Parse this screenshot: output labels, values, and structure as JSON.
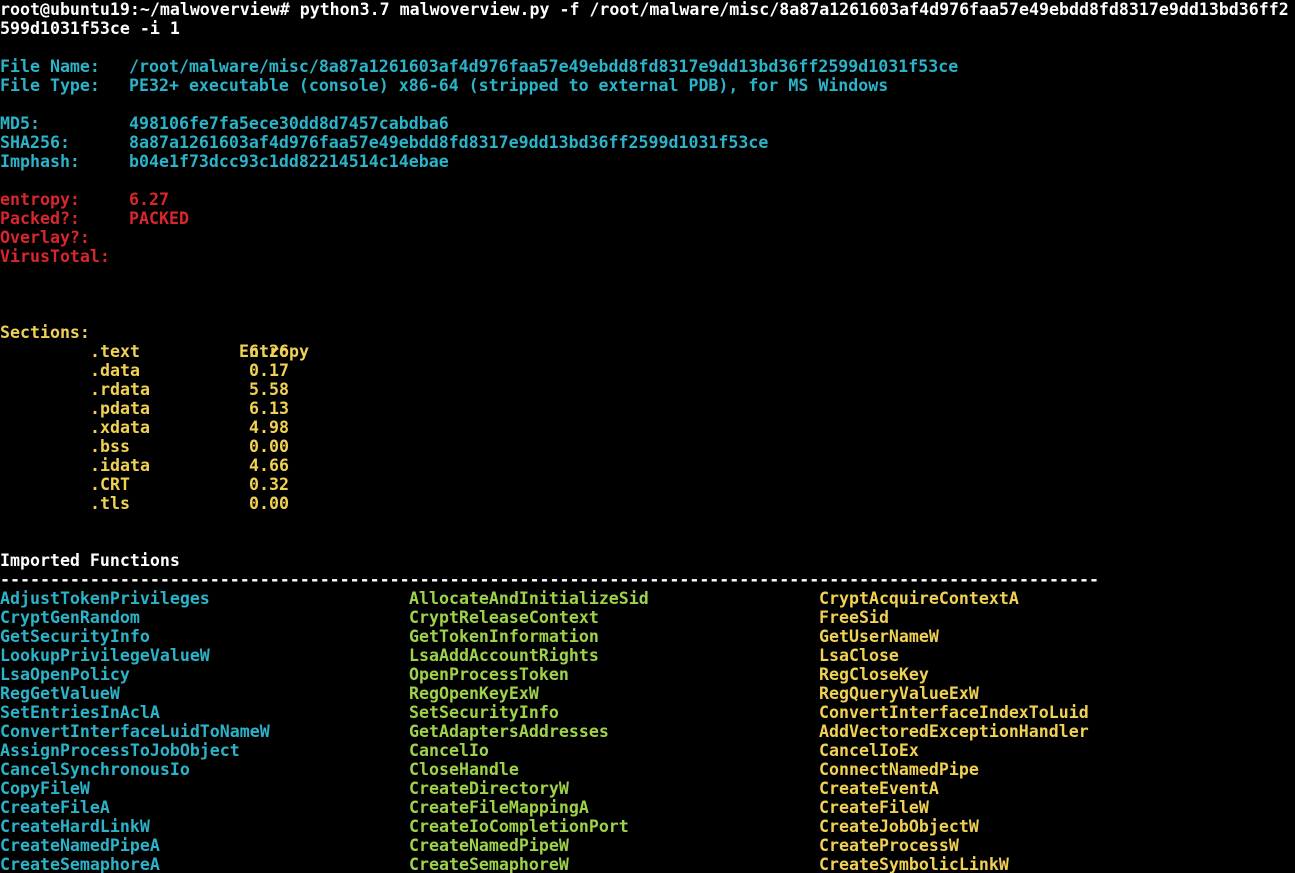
{
  "command": {
    "line1": "root@ubuntu19:~/malwoverview# python3.7 malwoverview.py -f /root/malware/misc/8a87a1261603af4d976faa57e49ebdd8fd8317e9dd13bd36ff2",
    "line2": "599d1031f53ce -i 1"
  },
  "file_info": {
    "name_label": "File Name:",
    "name_value": "/root/malware/misc/8a87a1261603af4d976faa57e49ebdd8fd8317e9dd13bd36ff2599d1031f53ce",
    "type_label": "File Type:",
    "type_value": "PE32+ executable (console) x86-64 (stripped to external PDB), for MS Windows"
  },
  "hashes": {
    "md5_label": "MD5:",
    "md5_value": "498106fe7fa5ece30dd8d7457cabdba6",
    "sha256_label": "SHA256:",
    "sha256_value": "8a87a1261603af4d976faa57e49ebdd8fd8317e9dd13bd36ff2599d1031f53ce",
    "imphash_label": "Imphash:",
    "imphash_value": "b04e1f73dcc93c1dd82214514c14ebae"
  },
  "status": {
    "entropy_label": "entropy:",
    "entropy_value": "6.27",
    "packed_label": "Packed?:",
    "packed_value": "PACKED",
    "overlay_label": "Overlay?:",
    "virustotal_label": "VirusTotal:"
  },
  "sections": {
    "header_label": "Sections:",
    "header_entropy": "Entropy",
    "rows": [
      {
        "name": ".text",
        "entropy": "6.26"
      },
      {
        "name": ".data",
        "entropy": "0.17"
      },
      {
        "name": ".rdata",
        "entropy": "5.58"
      },
      {
        "name": ".pdata",
        "entropy": "6.13"
      },
      {
        "name": ".xdata",
        "entropy": "4.98"
      },
      {
        "name": ".bss",
        "entropy": "0.00"
      },
      {
        "name": ".idata",
        "entropy": "4.66"
      },
      {
        "name": ".CRT",
        "entropy": "0.32"
      },
      {
        "name": ".tls",
        "entropy": "0.00"
      }
    ]
  },
  "imports": {
    "title": "Imported Functions",
    "separator": "--------------------------------------------------------------------------------------------------------------",
    "rows": [
      [
        "AdjustTokenPrivileges",
        "AllocateAndInitializeSid",
        "CryptAcquireContextA"
      ],
      [
        "CryptGenRandom",
        "CryptReleaseContext",
        "FreeSid"
      ],
      [
        "GetSecurityInfo",
        "GetTokenInformation",
        "GetUserNameW"
      ],
      [
        "LookupPrivilegeValueW",
        "LsaAddAccountRights",
        "LsaClose"
      ],
      [
        "LsaOpenPolicy",
        "OpenProcessToken",
        "RegCloseKey"
      ],
      [
        "RegGetValueW",
        "RegOpenKeyExW",
        "RegQueryValueExW"
      ],
      [
        "SetEntriesInAclA",
        "SetSecurityInfo",
        "ConvertInterfaceIndexToLuid"
      ],
      [
        "ConvertInterfaceLuidToNameW",
        "GetAdaptersAddresses",
        "AddVectoredExceptionHandler"
      ],
      [
        "AssignProcessToJobObject",
        "CancelIo",
        "CancelIoEx"
      ],
      [
        "CancelSynchronousIo",
        "CloseHandle",
        "ConnectNamedPipe"
      ],
      [
        "CopyFileW",
        "CreateDirectoryW",
        "CreateEventA"
      ],
      [
        "CreateFileA",
        "CreateFileMappingA",
        "CreateFileW"
      ],
      [
        "CreateHardLinkW",
        "CreateIoCompletionPort",
        "CreateJobObjectW"
      ],
      [
        "CreateNamedPipeA",
        "CreateNamedPipeW",
        "CreateProcessW"
      ],
      [
        "CreateSemaphoreA",
        "CreateSemaphoreW",
        "CreateSymbolicLinkW"
      ]
    ]
  },
  "colors": {
    "background": "#000000",
    "prompt": "#ffffff",
    "info": "#2bb3c9",
    "alert": "#d8272c",
    "sections": "#f0d154",
    "imports_col2": "#9ed24a"
  }
}
